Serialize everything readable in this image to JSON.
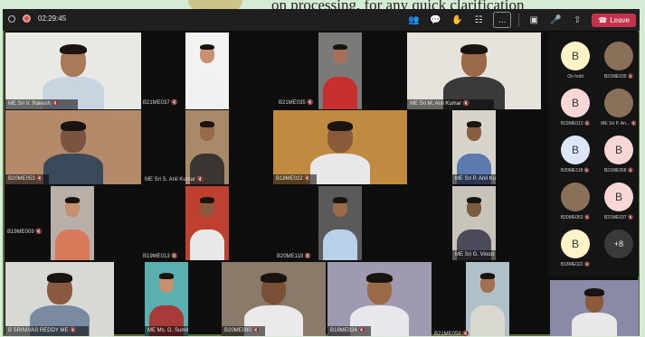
{
  "background_text": "on processing, for any quick clarification",
  "topbar": {
    "timer": "02:29:45",
    "leave_label": "Leave",
    "more_label": "..."
  },
  "tiles": [
    {
      "name": "ME Sri V. Rakesh",
      "bg": "#e8e8e4",
      "skin": "#a87a5a",
      "shirt": "#c8d4e0"
    },
    {
      "name": "B21ME037",
      "bg": "#f2f2f2",
      "skin": "#c89070",
      "shirt": "#f0f0f0"
    },
    {
      "name": "B21ME035",
      "bg": "#7a7a78",
      "skin": "#a87058",
      "shirt": "#c83030"
    },
    {
      "name": "ME Sri M. Anil Kumar",
      "bg": "#e6e2dc",
      "skin": "#9a6a48",
      "shirt": "#3a3a3a"
    },
    {
      "name": "B20ME053",
      "bg": "#b48a6a",
      "skin": "#7a5440",
      "shirt": "#3a4a5a"
    },
    {
      "name": "ME Sri S. Anil Kumar",
      "bg": "#a88a6a",
      "skin": "#9a6a48",
      "shirt": "#3a3530"
    },
    {
      "name": "B18ME022",
      "bg": "#c08a40",
      "skin": "#8a5a3a",
      "shirt": "#e8e8ea"
    },
    {
      "name": "ME Sri P. Anil Kumar",
      "bg": "#d8d4cc",
      "skin": "#8a5e40",
      "shirt": "#5a7ab0"
    },
    {
      "name": "B19ME009",
      "bg": "#b8b0a8",
      "skin": "#c49070",
      "shirt": "#d87a5a"
    },
    {
      "name": "B19ME013",
      "bg": "#c04030",
      "skin": "#8a5a40",
      "shirt": "#e8e8e8"
    },
    {
      "name": "B20ME118",
      "bg": "#5a5a5a",
      "skin": "#9a6a4a",
      "shirt": "#b8d0e8"
    },
    {
      "name": "ME Sri G. Vinod Kumar",
      "bg": "#c8c4bc",
      "skin": "#7a5a40",
      "shirt": "#4a4a5a"
    },
    {
      "name": "B SRINIVAS REDDY ME",
      "bg": "#d8d8d4",
      "skin": "#8a5a40",
      "shirt": "#7a8aa0"
    },
    {
      "name": "ME Ms. G. Sumithra",
      "bg": "#5ab0b0",
      "skin": "#c49070",
      "shirt": "#a83a3a"
    },
    {
      "name": "B20ME090",
      "bg": "#8a7a6a",
      "skin": "#7a5038",
      "shirt": "#eaeaea"
    },
    {
      "name": "B18ME024",
      "bg": "#a09ab0",
      "skin": "#9a6a48",
      "shirt": "#e8e8ec"
    },
    {
      "name": "B21ME058",
      "bg": "#b0c0c8",
      "skin": "#a07050",
      "shirt": "#d8d8d0"
    },
    {
      "name": "",
      "bg": "#8a8aa8",
      "skin": "#8a5a3a",
      "shirt": "#e8e8e8"
    }
  ],
  "participants": [
    {
      "initial": "B",
      "name": "On hold",
      "type": "letter"
    },
    {
      "initial": "",
      "name": "B21ME035",
      "type": "photo"
    },
    {
      "initial": "B",
      "name": "B19ME013",
      "type": "letter"
    },
    {
      "initial": "",
      "name": "ME Sri P. An...",
      "type": "photo"
    },
    {
      "initial": "B",
      "name": "B20ME118",
      "type": "letter"
    },
    {
      "initial": "B",
      "name": "B21ME058",
      "type": "letter"
    },
    {
      "initial": "",
      "name": "B20ME053",
      "type": "photo"
    },
    {
      "initial": "B",
      "name": "B21ME037",
      "type": "letter"
    },
    {
      "initial": "B",
      "name": "B18ME022",
      "type": "letter"
    },
    {
      "initial": "+8",
      "name": "",
      "type": "more"
    }
  ],
  "colors": {
    "leave": "#c4314b",
    "avatar_letter_bg": "#fdf3c8",
    "avatar_alt_bg": "#f7d6d6"
  }
}
